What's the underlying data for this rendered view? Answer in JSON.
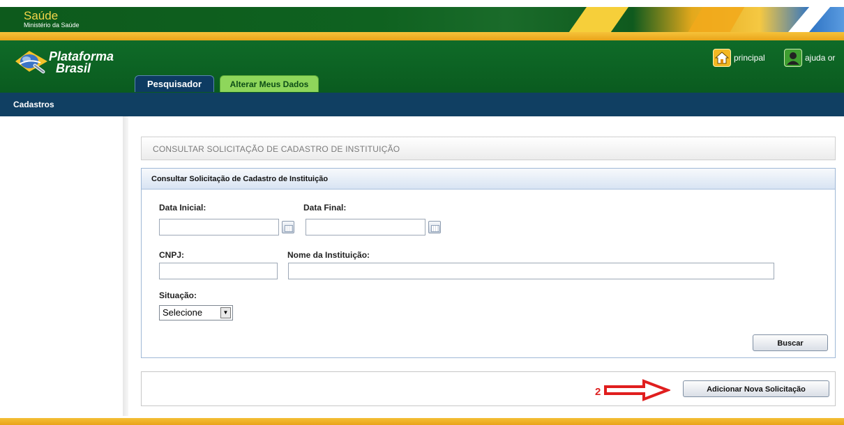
{
  "ministry": {
    "title": "Saúde",
    "subtitle": "Ministério da Saúde"
  },
  "brand": {
    "line1": "Plataforma",
    "line2": "Brasil"
  },
  "tabs": [
    {
      "label": "Pesquisador",
      "active": true
    },
    {
      "label": "Alterar Meus Dados",
      "active": false
    }
  ],
  "header_links": {
    "home_label": "principal",
    "help_label": "ajuda or"
  },
  "nav": {
    "item": "Cadastros"
  },
  "page": {
    "title": "CONSULTAR SOLICITAÇÃO DE CADASTRO DE INSTITUIÇÃO",
    "panel_title": "Consultar Solicitação de Cadastro de Instituição"
  },
  "form": {
    "data_inicial_label": "Data Inicial:",
    "data_inicial_value": "",
    "data_final_label": "Data Final:",
    "data_final_value": "",
    "cnpj_label": "CNPJ:",
    "cnpj_value": "",
    "nome_label": "Nome da Instituição:",
    "nome_value": "",
    "situacao_label": "Situação:",
    "situacao_selected": "Selecione",
    "buscar_label": "Buscar"
  },
  "actions": {
    "step_number": "2",
    "add_label": "Adicionar Nova Solicitação"
  },
  "colors": {
    "header_green": "#0f6b28",
    "nav_blue": "#103f62",
    "accent_yellow": "#f4b823",
    "annotation_red": "#d22222"
  }
}
